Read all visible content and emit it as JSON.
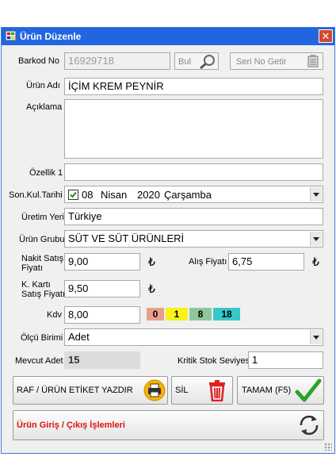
{
  "window": {
    "title": "Ürün Düzenle",
    "close_glyph": "✕"
  },
  "barcode": {
    "label": "Barkod No",
    "value": "16929718",
    "search_label": "Bul",
    "serial_label": "Seri No Getir"
  },
  "product_name": {
    "label": "Ürün Adı",
    "value": "İÇİM KREM PEYNİR"
  },
  "description": {
    "label": "Açıklama",
    "value": ""
  },
  "feature1": {
    "label": "Özellik 1",
    "value": ""
  },
  "expiry": {
    "label": "Son.Kul.Tarihi",
    "checked": true,
    "day": "08",
    "month": "Nisan",
    "year": "2020",
    "weekday": "Çarşamba"
  },
  "origin": {
    "label": "Üretim Yeri",
    "value": "Türkiye"
  },
  "group": {
    "label": "Ürün Grubu",
    "value": "SÜT VE SÜT ÜRÜNLERİ"
  },
  "cash_price": {
    "label_line1": "Nakit Satış",
    "label_line2": "Fiyatı",
    "value": "9,00",
    "currency": "₺"
  },
  "purchase_price": {
    "label": "Alış Fiyatı",
    "value": "6,75",
    "currency": "₺"
  },
  "card_price": {
    "label_line1": "K. Kartı",
    "label_line2": "Satış Fiyatı",
    "value": "9,50",
    "currency": "₺"
  },
  "vat": {
    "label": "Kdv",
    "value": "8,00",
    "rates": [
      "0",
      "1",
      "8",
      "18"
    ],
    "rate_colors": [
      "#e8a08a",
      "#f7f21a",
      "#8fc79a",
      "#35c9c9"
    ]
  },
  "unit": {
    "label": "Ölçü Birimi",
    "value": "Adet"
  },
  "stock": {
    "label": "Mevcut Adet",
    "value": "15",
    "critical_label": "Kritik Stok Seviyesi",
    "critical_value": "1"
  },
  "buttons": {
    "print_label": "RAF / ÜRÜN ETİKET YAZDIR",
    "delete_label": "SİL",
    "ok_label": "TAMAM (F5)",
    "movements_label": "Ürün Giriş / Çıkış İşlemleri"
  },
  "colors": {
    "titlebar": "#2166e0",
    "movements_text": "#e01010",
    "check_green": "#2aa52a",
    "delete_red": "#e02020"
  }
}
